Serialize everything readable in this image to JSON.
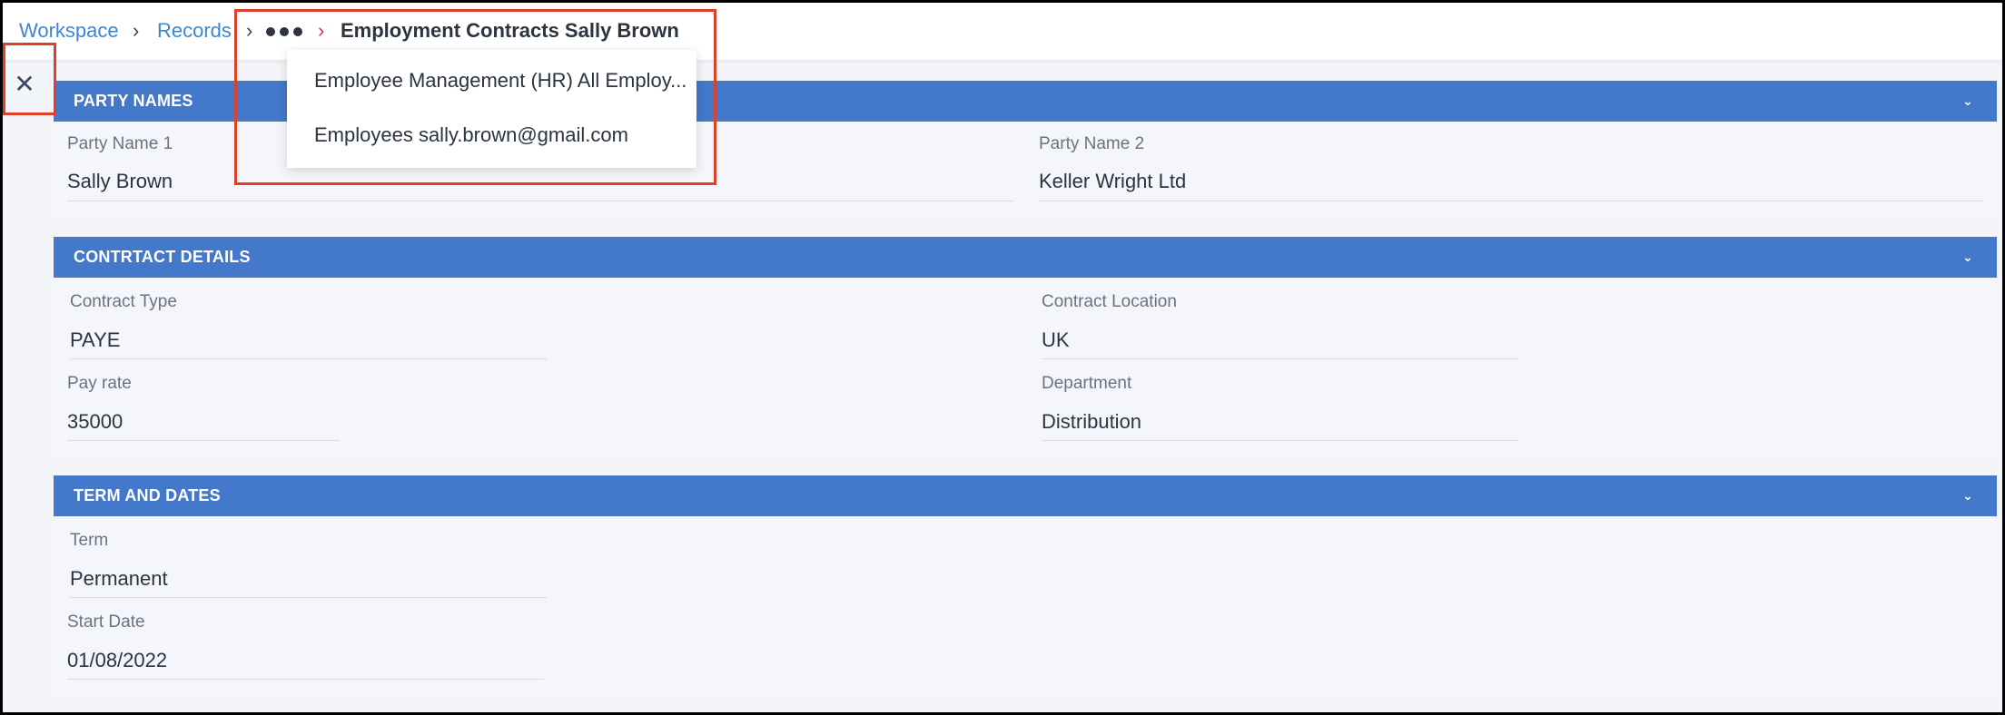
{
  "breadcrumb": {
    "items": [
      "Workspace",
      "Records"
    ],
    "current": "Employment Contracts Sally Brown",
    "overflow_menu": [
      "Employee Management (HR) All Employ...",
      "Employees sally.brown@gmail.com"
    ]
  },
  "sections": {
    "party_names": {
      "title": "PARTY NAMES",
      "party_name_1_label": "Party Name 1",
      "party_name_1_value": "Sally Brown",
      "party_name_2_label": "Party Name 2",
      "party_name_2_value": "Keller Wright Ltd"
    },
    "contract_details": {
      "title": "CONTRTACT DETAILS",
      "contract_type_label": "Contract Type",
      "contract_type_value": "PAYE",
      "contract_location_label": "Contract Location",
      "contract_location_value": "UK",
      "pay_rate_label": "Pay rate",
      "pay_rate_value": "35000",
      "department_label": "Department",
      "department_value": "Distribution"
    },
    "term_and_dates": {
      "title": "TERM AND DATES",
      "term_label": "Term",
      "term_value": "Permanent",
      "start_date_label": "Start Date",
      "start_date_value": "01/08/2022"
    }
  },
  "colors": {
    "section_header": "#4478cb",
    "link": "#3d86d4",
    "highlight": "#e0402a"
  }
}
